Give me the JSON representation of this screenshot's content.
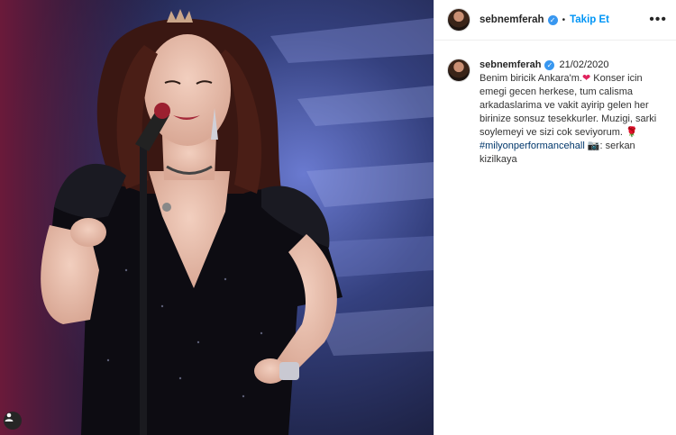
{
  "post": {
    "username": "sebnemferah",
    "follow_label": "Takip Et",
    "separator": "•",
    "more_label": "•••",
    "verified_mark": "✓"
  },
  "caption": {
    "username": "sebnemferah",
    "date": "21/02/2020",
    "text_1": "Benim biricik Ankara'm.",
    "heart": "❤",
    "text_2": " Konser icin emegi gecen herkese, tum calisma arkadaslarima ve vakit ayirip gelen her birinize sonsuz tesekkurler. Muzigi, sarki soylemeyi ve sizi cok seviyorum. ",
    "flower": "🌹",
    "hashtag": "#milyonperformancehall",
    "camera": "📷",
    "text_3": ": serkan kizilkaya"
  },
  "icons": {
    "user_tag": "user-icon",
    "camera": "camera-icon",
    "verified": "verified-badge-icon",
    "more": "more-options-icon"
  },
  "colors": {
    "follow": "#0095f6",
    "verified": "#3897f0",
    "heart": "#e0245e",
    "hashtag": "#00376b"
  }
}
